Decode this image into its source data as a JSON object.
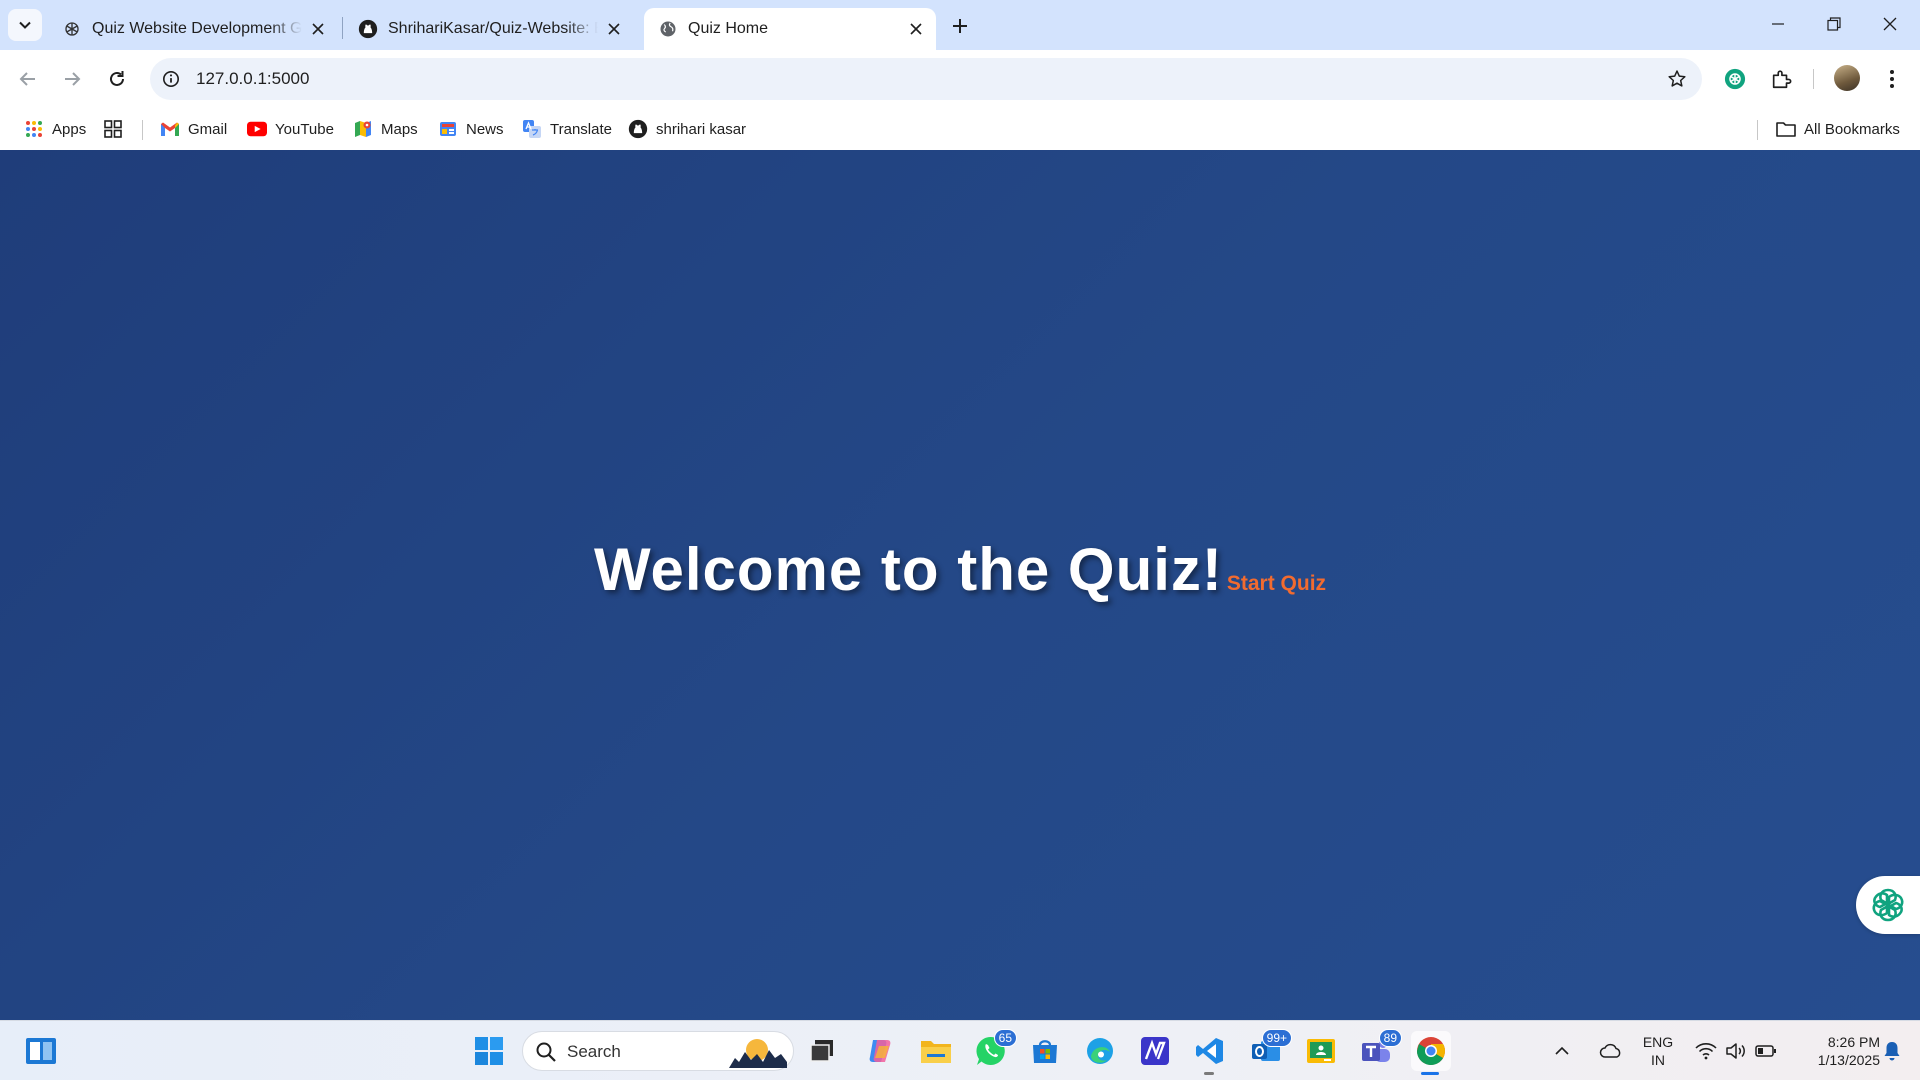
{
  "browser": {
    "tabs": [
      {
        "title": "Quiz Website Development Guide",
        "favicon": "chatgpt-icon",
        "active": false
      },
      {
        "title": "ShrihariKasar/Quiz-Website: Easy",
        "favicon": "github-icon",
        "active": false
      },
      {
        "title": "Quiz Home",
        "favicon": "globe-icon",
        "active": true
      }
    ],
    "address": "127.0.0.1:5000",
    "bookmarks": [
      {
        "label": "Apps",
        "icon": "apps-grid-icon"
      },
      {
        "label": "Gmail",
        "icon": "gmail-icon"
      },
      {
        "label": "YouTube",
        "icon": "youtube-icon"
      },
      {
        "label": "Maps",
        "icon": "maps-icon"
      },
      {
        "label": "News",
        "icon": "news-icon"
      },
      {
        "label": "Translate",
        "icon": "translate-icon"
      },
      {
        "label": "shrihari kasar",
        "icon": "github-icon"
      }
    ],
    "all_bookmarks_label": "All Bookmarks"
  },
  "page": {
    "heading": "Welcome to the Quiz!",
    "start_link": "Start Quiz",
    "colors": {
      "background": "#244887",
      "heading": "#ffffff",
      "link": "#f26b2f"
    }
  },
  "taskbar": {
    "search_placeholder": "Search",
    "badges": {
      "whatsapp": "65",
      "outlook": "99+",
      "teams": "89"
    },
    "language": "ENG",
    "region": "IN",
    "time": "8:26 PM",
    "date": "1/13/2025"
  }
}
